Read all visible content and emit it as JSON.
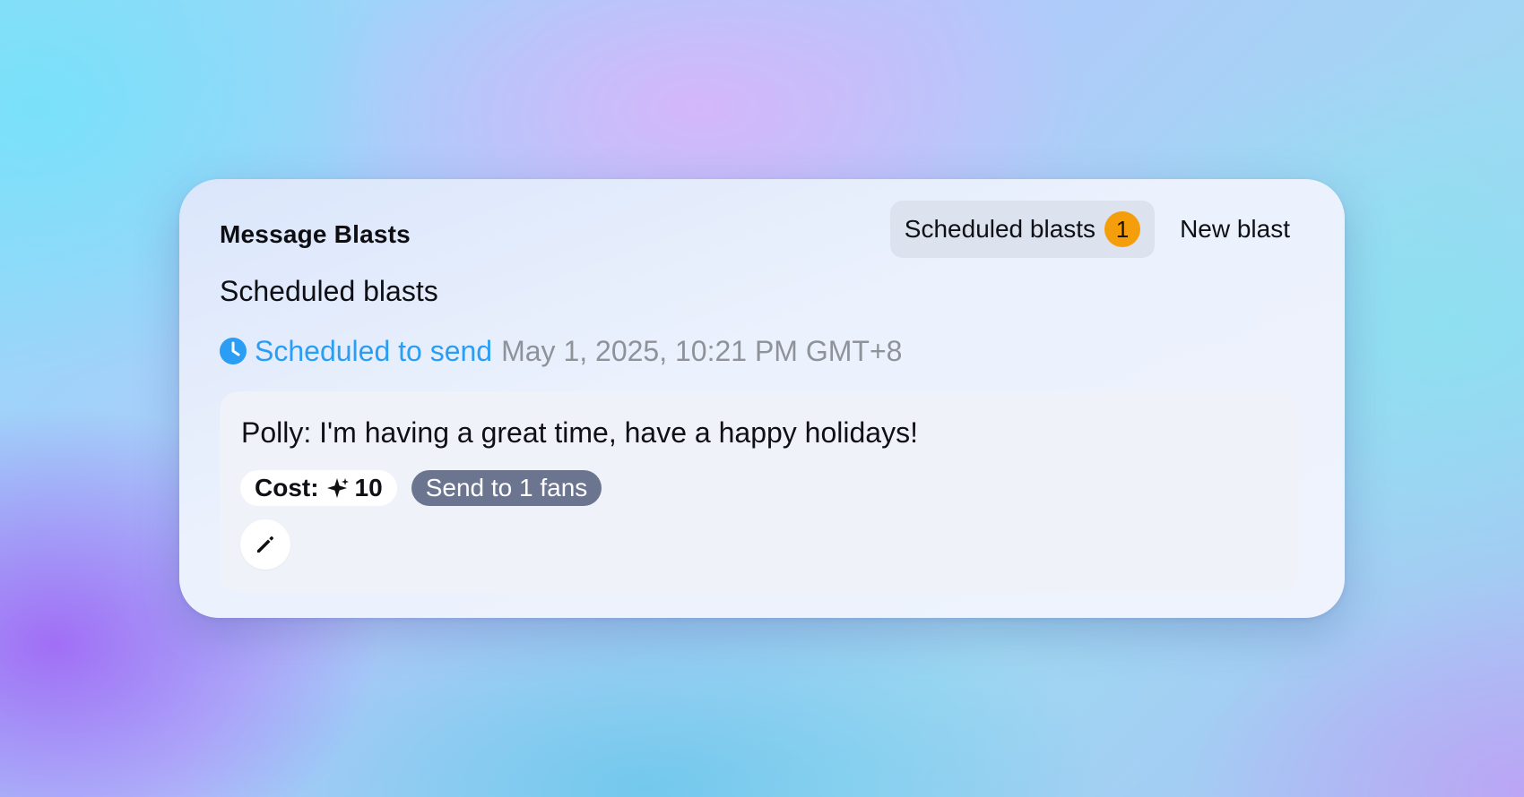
{
  "card": {
    "title": "Message Blasts",
    "tabs": [
      {
        "label": "Scheduled blasts",
        "badge": "1",
        "active": true
      },
      {
        "label": "New blast",
        "active": false
      }
    ],
    "section_heading": "Scheduled blasts"
  },
  "scheduled_item": {
    "status_label": "Scheduled to send",
    "date": "May 1, 2025, 10:21 PM GMT+8",
    "message": "Polly: I'm having a great time, have a happy holidays!",
    "cost_label": "Cost:",
    "cost_value": "10",
    "send_label": "Send to 1 fans"
  },
  "icons": {
    "status": "clock-icon",
    "cost": "sparkle-icon",
    "edit": "pencil-icon"
  },
  "colors": {
    "accent_blue": "#2a9df4",
    "badge_orange": "#f59e0b",
    "send_chip": "#6b7590",
    "muted_text": "#8f9299"
  }
}
